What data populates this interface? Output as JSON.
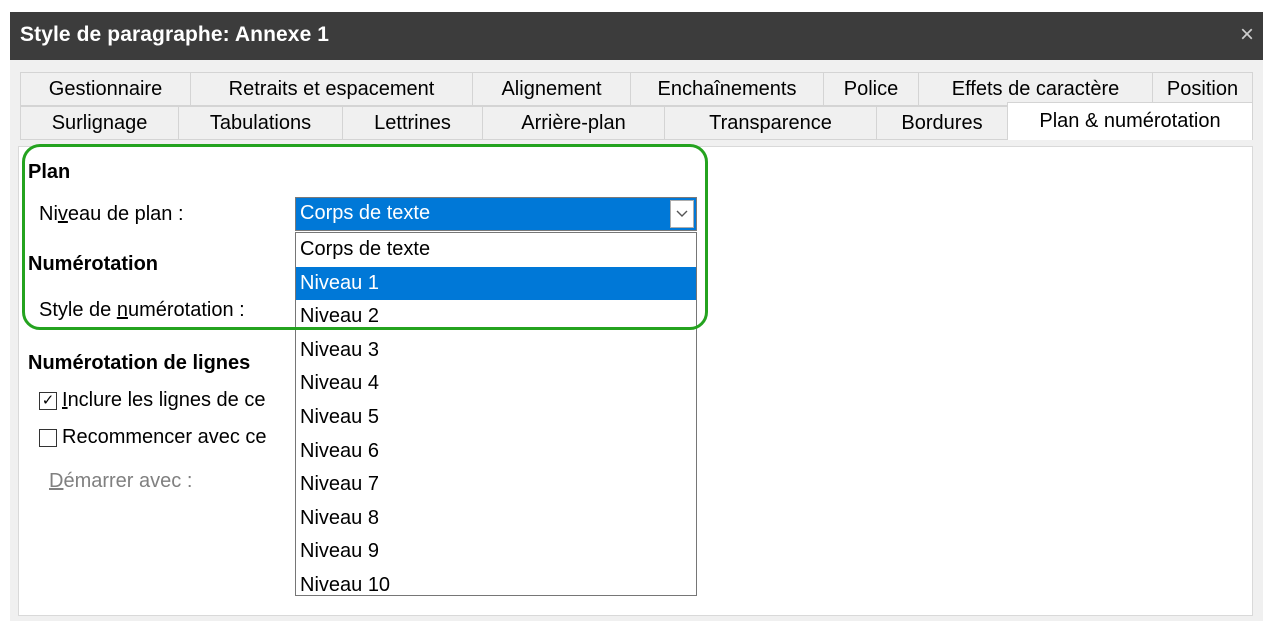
{
  "window": {
    "title": "Style de paragraphe: Annexe 1",
    "close_glyph": "×"
  },
  "tabs": {
    "row1": [
      "Gestionnaire",
      "Retraits et espacement",
      "Alignement",
      "Enchaînements",
      "Police",
      "Effets de caractère",
      "Position"
    ],
    "row2": [
      "Surlignage",
      "Tabulations",
      "Lettrines",
      "Arrière-plan",
      "Transparence",
      "Bordures",
      "Plan & numérotation"
    ],
    "active": "Plan & numérotation"
  },
  "plan": {
    "heading": "Plan",
    "level_label_pre": "Ni",
    "level_label_u": "v",
    "level_label_post": "eau de plan :",
    "level_value": "Corps de texte",
    "options": [
      "Corps de texte",
      "Niveau 1",
      "Niveau 2",
      "Niveau 3",
      "Niveau 4",
      "Niveau 5",
      "Niveau 6",
      "Niveau 7",
      "Niveau 8",
      "Niveau 9",
      "Niveau 10"
    ],
    "highlighted_option": "Niveau 1"
  },
  "numbering": {
    "heading": "Numérotation",
    "style_label_pre": "Style de ",
    "style_label_u": "n",
    "style_label_post": "umérotation :"
  },
  "line_numbering": {
    "heading": "Numérotation de lignes",
    "include_label_u": "I",
    "include_label_post": "nclure les lignes de ce",
    "include_checked": true,
    "restart_label": "Recommencer avec ce",
    "restart_checked": false,
    "start_label_u": "D",
    "start_label_post": "émarrer avec :"
  },
  "colors": {
    "titlebar": "#3c3c3c",
    "accent": "#0078d7",
    "highlight_border": "#24a31f"
  }
}
